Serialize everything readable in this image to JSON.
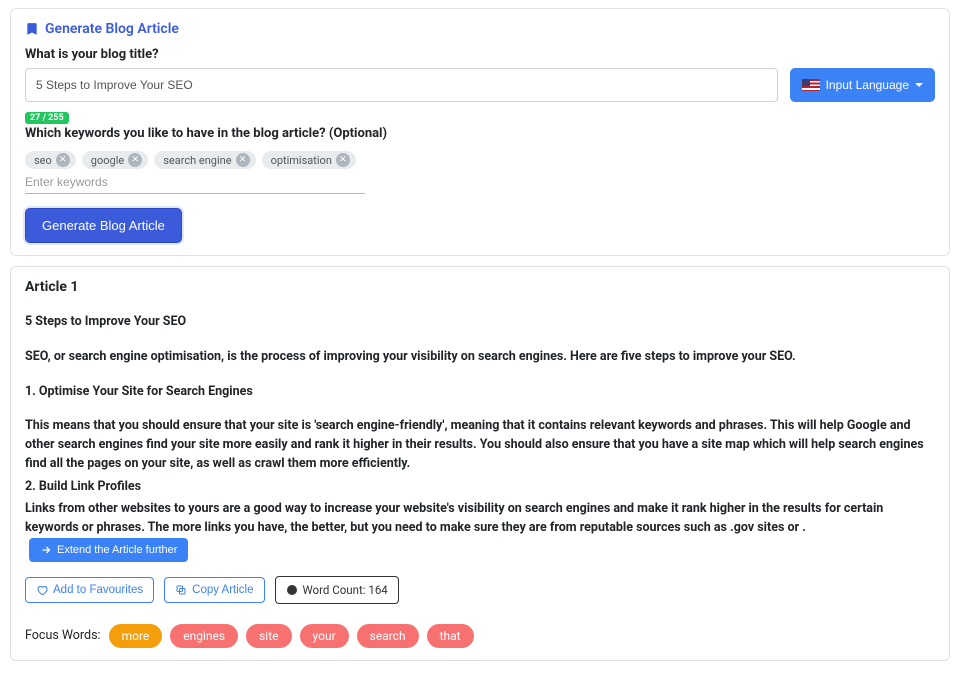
{
  "header": {
    "title": "Generate Blog Article"
  },
  "form": {
    "title_label": "What is your blog title?",
    "title_value": "5 Steps to Improve Your SEO",
    "lang_button": "Input Language",
    "counter": "27 / 255",
    "keywords_label": "Which keywords you like to have in the blog article? (Optional)",
    "keywords": [
      "seo",
      "google",
      "search engine",
      "optimisation"
    ],
    "keywords_placeholder": "Enter keywords",
    "generate_label": "Generate Blog Article"
  },
  "article": {
    "heading": "Article 1",
    "title": "5 Steps to Improve Your SEO",
    "intro": "SEO, or search engine optimisation, is the process of improving your visibility on search engines. Here are five steps to improve your SEO.",
    "step1_head": "1. Optimise Your Site for Search Engines",
    "step1_body": "This means that you should ensure that your site is 'search engine-friendly', meaning that it contains relevant keywords and phrases. This will help Google and other search engines find your site more easily and rank it higher in their results. You should also ensure that you have a site map which will help search engines find all the pages on your site, as well as crawl them more efficiently.",
    "step2_head": "2. Build Link Profiles",
    "step2_body": "Links from other websites to yours are a good way to increase your website's visibility on search engines and make it rank higher in the results for certain keywords or phrases. The more links you have, the better, but you need to make sure they are from reputable sources such as .gov sites or .",
    "extend_label": "Extend the Article further",
    "fav_label": "Add to Favourites",
    "copy_label": "Copy Article",
    "wordcount_label": "Word Count: 164",
    "focus_label": "Focus Words:",
    "focus_words": [
      "more",
      "engines",
      "site",
      "your",
      "search",
      "that"
    ]
  }
}
